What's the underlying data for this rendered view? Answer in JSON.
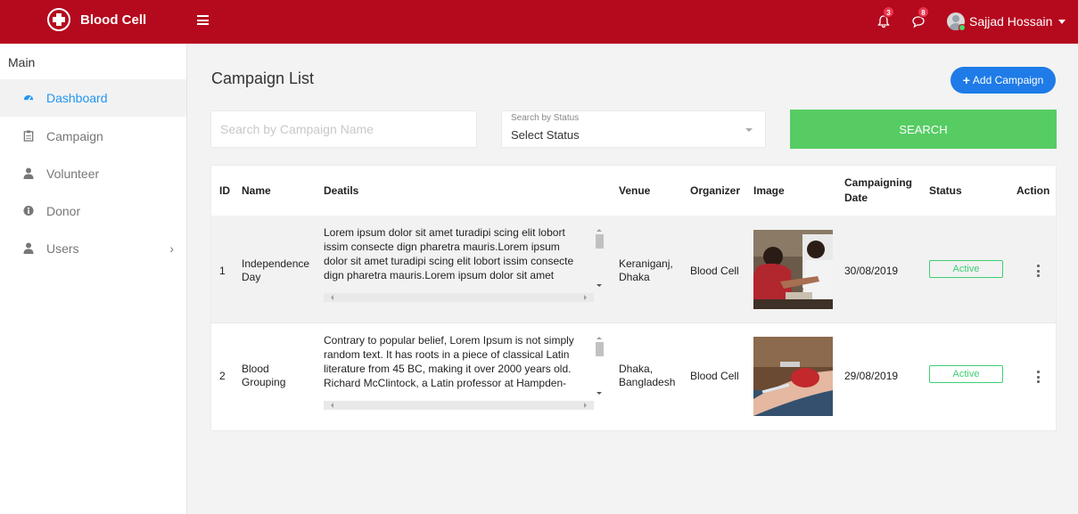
{
  "app": {
    "brand_name": "Blood Cell",
    "notification_count": "3",
    "message_count": "8",
    "user_name": "Sajjad Hossain"
  },
  "sidebar": {
    "heading": "Main",
    "items": [
      {
        "label": "Dashboard",
        "icon": "tachometer-icon",
        "active": true
      },
      {
        "label": "Campaign",
        "icon": "clipboard-icon",
        "active": false
      },
      {
        "label": "Volunteer",
        "icon": "user-icon",
        "active": false
      },
      {
        "label": "Donor",
        "icon": "info-circle-icon",
        "active": false
      },
      {
        "label": "Users",
        "icon": "user-icon",
        "active": false,
        "expandable": true
      }
    ]
  },
  "main": {
    "title": "Campaign List",
    "add_button": "Add Campaign",
    "search_placeholder": "Search by Campaign Name",
    "status_label": "Search by Status",
    "status_value": "Select Status",
    "search_button": "SEARCH"
  },
  "table": {
    "headers": {
      "id": "ID",
      "name": "Name",
      "details": "Deatils",
      "venue": "Venue",
      "organizer": "Organizer",
      "image": "Image",
      "date_line1": "Campaigning",
      "date_line2": "Date",
      "status": "Status",
      "action": "Action"
    },
    "rows": [
      {
        "id": "1",
        "name_line1": "Independence",
        "name_line2": "Day",
        "details_lines": [
          "Lorem ipsum dolor sit amet turadipi scing elit lobort",
          "issim consecte dign pharetra mauris.Lorem ipsum",
          "dolor sit amet turadipi scing elit lobort issim consecte",
          "dign pharetra mauris.Lorem ipsum dolor sit amet"
        ],
        "venue_line1": "Keraniganj,",
        "venue_line2": "Dhaka",
        "organizer": "Blood Cell",
        "date": "30/08/2019",
        "status": "Active"
      },
      {
        "id": "2",
        "name_line1": "Blood",
        "name_line2": "Grouping",
        "details_lines": [
          "Contrary to popular belief, Lorem Ipsum is not simply",
          "random text. It has roots in a piece of classical Latin",
          "literature from 45 BC, making it over 2000 years old.",
          "Richard McClintock, a Latin professor at Hampden-"
        ],
        "venue_line1": "Dhaka,",
        "venue_line2": "Bangladesh",
        "organizer": "Blood Cell",
        "date": "29/08/2019",
        "status": "Active"
      }
    ]
  },
  "colors": {
    "topbar": "#b5091e",
    "active_nav": "#2196f3",
    "add_button": "#1e7be7",
    "search_button": "#56cc63",
    "status_active": "#3ecf74"
  }
}
